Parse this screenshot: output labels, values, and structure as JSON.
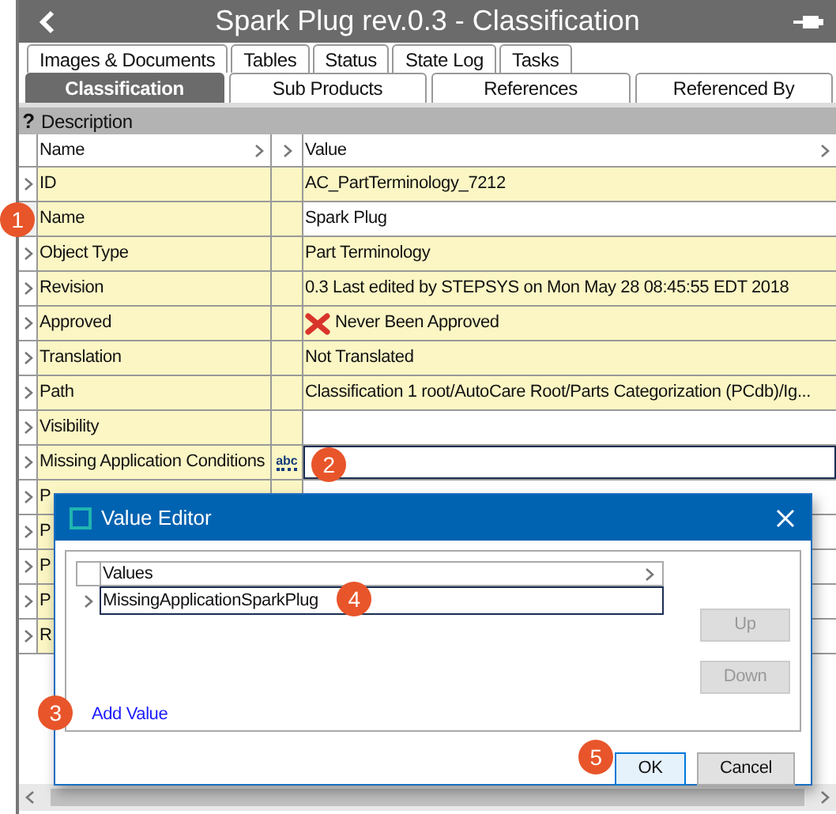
{
  "window": {
    "title": "Spark Plug rev.0.3 - Classification"
  },
  "tab_rows": [
    [
      {
        "label": "Images & Documents",
        "selected": false
      },
      {
        "label": "Tables",
        "selected": false
      },
      {
        "label": "Status",
        "selected": false
      },
      {
        "label": "State Log",
        "selected": false
      },
      {
        "label": "Tasks",
        "selected": false
      }
    ],
    [
      {
        "label": "Classification",
        "selected": true
      },
      {
        "label": "Sub Products",
        "selected": false
      },
      {
        "label": "References",
        "selected": false
      },
      {
        "label": "Referenced By",
        "selected": false
      }
    ]
  ],
  "section": {
    "help": "?",
    "title": "Description"
  },
  "table": {
    "columns": [
      "Name",
      "Value"
    ],
    "rows": [
      {
        "name": "ID",
        "value": "AC_PartTerminology_7212",
        "kind": "text",
        "editable": false,
        "current": false
      },
      {
        "name": "Name",
        "value": "Spark Plug",
        "kind": "text",
        "editable": true,
        "current": true
      },
      {
        "name": "Object Type",
        "value": "Part Terminology",
        "kind": "text",
        "editable": false,
        "current": false
      },
      {
        "name": "Revision",
        "value": "0.3 Last edited by STEPSYS on Mon May 28 08:45:55 EDT 2018",
        "kind": "text",
        "editable": false,
        "current": false
      },
      {
        "name": "Approved",
        "value": "Never Been Approved",
        "kind": "rejected",
        "editable": false,
        "current": false
      },
      {
        "name": "Translation",
        "value": "Not Translated",
        "kind": "text",
        "editable": false,
        "current": false
      },
      {
        "name": "Path",
        "value": "Classification 1 root/AutoCare Root/Parts Categorization (PCdb)/Ig...",
        "kind": "text",
        "editable": false,
        "current": false
      },
      {
        "name": "Visibility",
        "kind": "text",
        "editable": true,
        "current": false
      },
      {
        "name": "Missing Application Conditions",
        "kind": "editing",
        "type_icon": "abc",
        "current": false
      },
      {
        "name": "P",
        "kind": "hidden",
        "current": false
      },
      {
        "name": "P",
        "kind": "hidden",
        "current": false
      },
      {
        "name": "P",
        "kind": "hidden",
        "current": false
      },
      {
        "name": "P",
        "kind": "hidden",
        "current": false
      },
      {
        "name": "R",
        "kind": "hidden",
        "current": false
      }
    ]
  },
  "dialog": {
    "title": "Value Editor",
    "column": "Values",
    "values": [
      "MissingApplicationSparkPlug"
    ],
    "link": "Add Value",
    "side_buttons": [
      {
        "label": "Up",
        "disabled": true
      },
      {
        "label": "Down",
        "disabled": true
      }
    ],
    "buttons": [
      {
        "label": "OK",
        "default": true
      },
      {
        "label": "Cancel",
        "default": false
      }
    ]
  },
  "annotations": [
    {
      "label": "1"
    },
    {
      "label": "2"
    },
    {
      "label": "3"
    },
    {
      "label": "4"
    },
    {
      "label": "5"
    }
  ]
}
